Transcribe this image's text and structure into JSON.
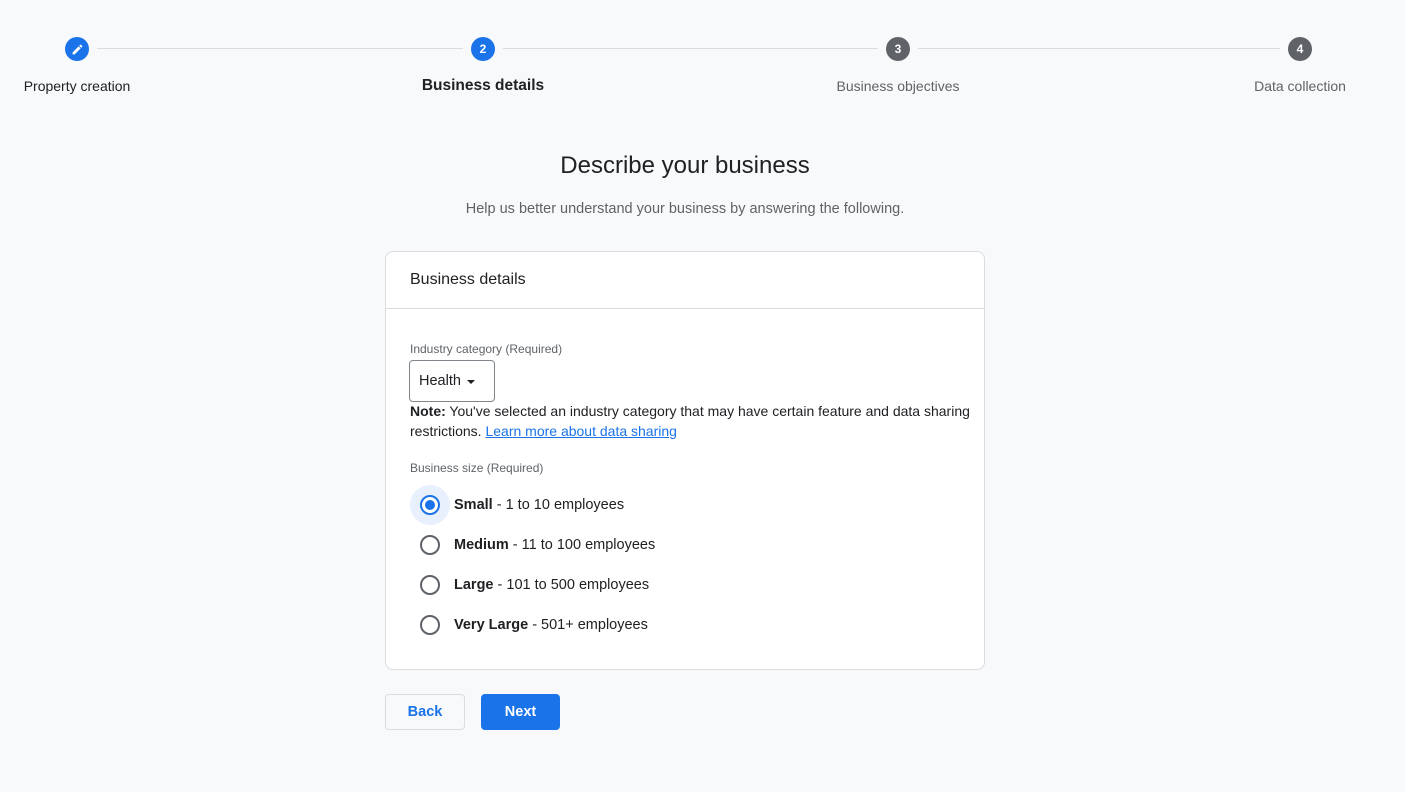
{
  "stepper": {
    "steps": [
      {
        "number": "",
        "label": "Property creation",
        "status": "done",
        "icon": "pencil-icon"
      },
      {
        "number": "2",
        "label": "Business details",
        "status": "active"
      },
      {
        "number": "3",
        "label": "Business objectives",
        "status": "pending"
      },
      {
        "number": "4",
        "label": "Data collection",
        "status": "pending"
      }
    ]
  },
  "header": {
    "title": "Describe your business",
    "subtitle": "Help us better understand your business by answering the following."
  },
  "card": {
    "title": "Business details",
    "industry": {
      "label": "Industry category (Required)",
      "selected": "Health"
    },
    "note": {
      "prefix": "Note:",
      "text": " You've selected an industry category that may have certain feature and data sharing restrictions. ",
      "link": "Learn more about data sharing"
    },
    "size": {
      "label": "Business size (Required)",
      "options": [
        {
          "name": "Small",
          "detail": " - 1 to 10 employees",
          "checked": true
        },
        {
          "name": "Medium",
          "detail": " - 11 to 100 employees",
          "checked": false
        },
        {
          "name": "Large",
          "detail": " - 101 to 500 employees",
          "checked": false
        },
        {
          "name": "Very Large",
          "detail": " - 501+ employees",
          "checked": false
        }
      ]
    }
  },
  "buttons": {
    "back": "Back",
    "next": "Next"
  },
  "colors": {
    "accent": "#1a73e8",
    "pending": "#5f6368",
    "background": "#f8f9fa"
  }
}
